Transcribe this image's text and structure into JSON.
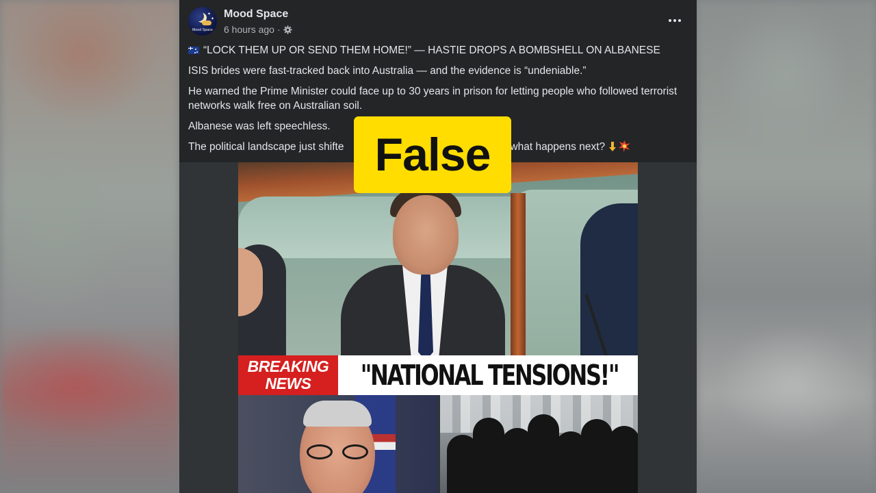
{
  "post": {
    "page_name": "Mood Space",
    "avatar_text": "Mood Space",
    "time": "6 hours ago",
    "separator": "·",
    "paragraphs": [
      "“LOCK THEM UP OR SEND THEM HOME!” — HASTIE DROPS A BOMBSHELL ON ALBANESE",
      "ISIS brides were fast-tracked back into Australia — and the evidence is “undeniable.”",
      "He warned the Prime Minister could face up to 30 years in prison for letting people who followed terrorist networks walk free on Australian soil.",
      "Albanese was left speechless."
    ],
    "last_line_start": "The political landscape just shifte",
    "last_line_end": "d what happens next? "
  },
  "image": {
    "breaking_line1": "BREAKING",
    "breaking_line2": "NEWS",
    "headline": "\"NATIONAL TENSIONS!\""
  },
  "overlay": {
    "verdict": "False"
  },
  "icons": {
    "flag": "australia-flag-icon",
    "privacy": "gear-icon",
    "more": "more-options-icon",
    "point_down": "point-down-emoji",
    "collision": "collision-emoji"
  },
  "colors": {
    "verdict_bg": "#ffdd00",
    "breaking_bg": "#d61f1f",
    "card_bg": "#242526"
  }
}
